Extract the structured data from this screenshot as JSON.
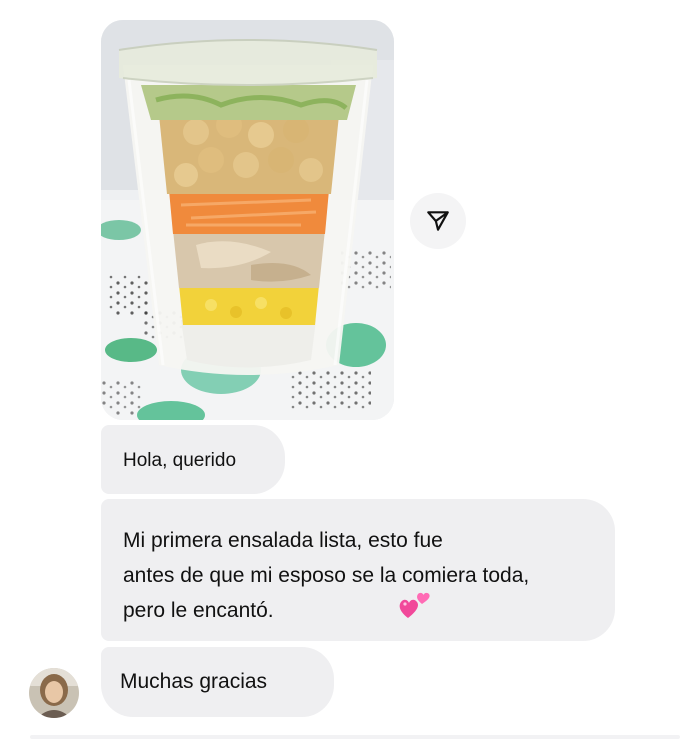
{
  "thread": {
    "photo": {
      "subject": "layered salad in plastic cup"
    },
    "share_icon": "send-paper-plane-icon",
    "messages": [
      {
        "text": "Hola, querido"
      },
      {
        "lines": [
          "Mi primera ensalada lista, esto fue",
          "antes de que mi esposo se la comiera toda,",
          "pero le encantó."
        ],
        "emoji": "💕"
      },
      {
        "text": "Muchas gracias"
      }
    ],
    "avatar_icon": "user-avatar"
  },
  "colors": {
    "bubble_bg": "#efeff1",
    "text": "#111111",
    "heart": "#ff4fa3"
  }
}
